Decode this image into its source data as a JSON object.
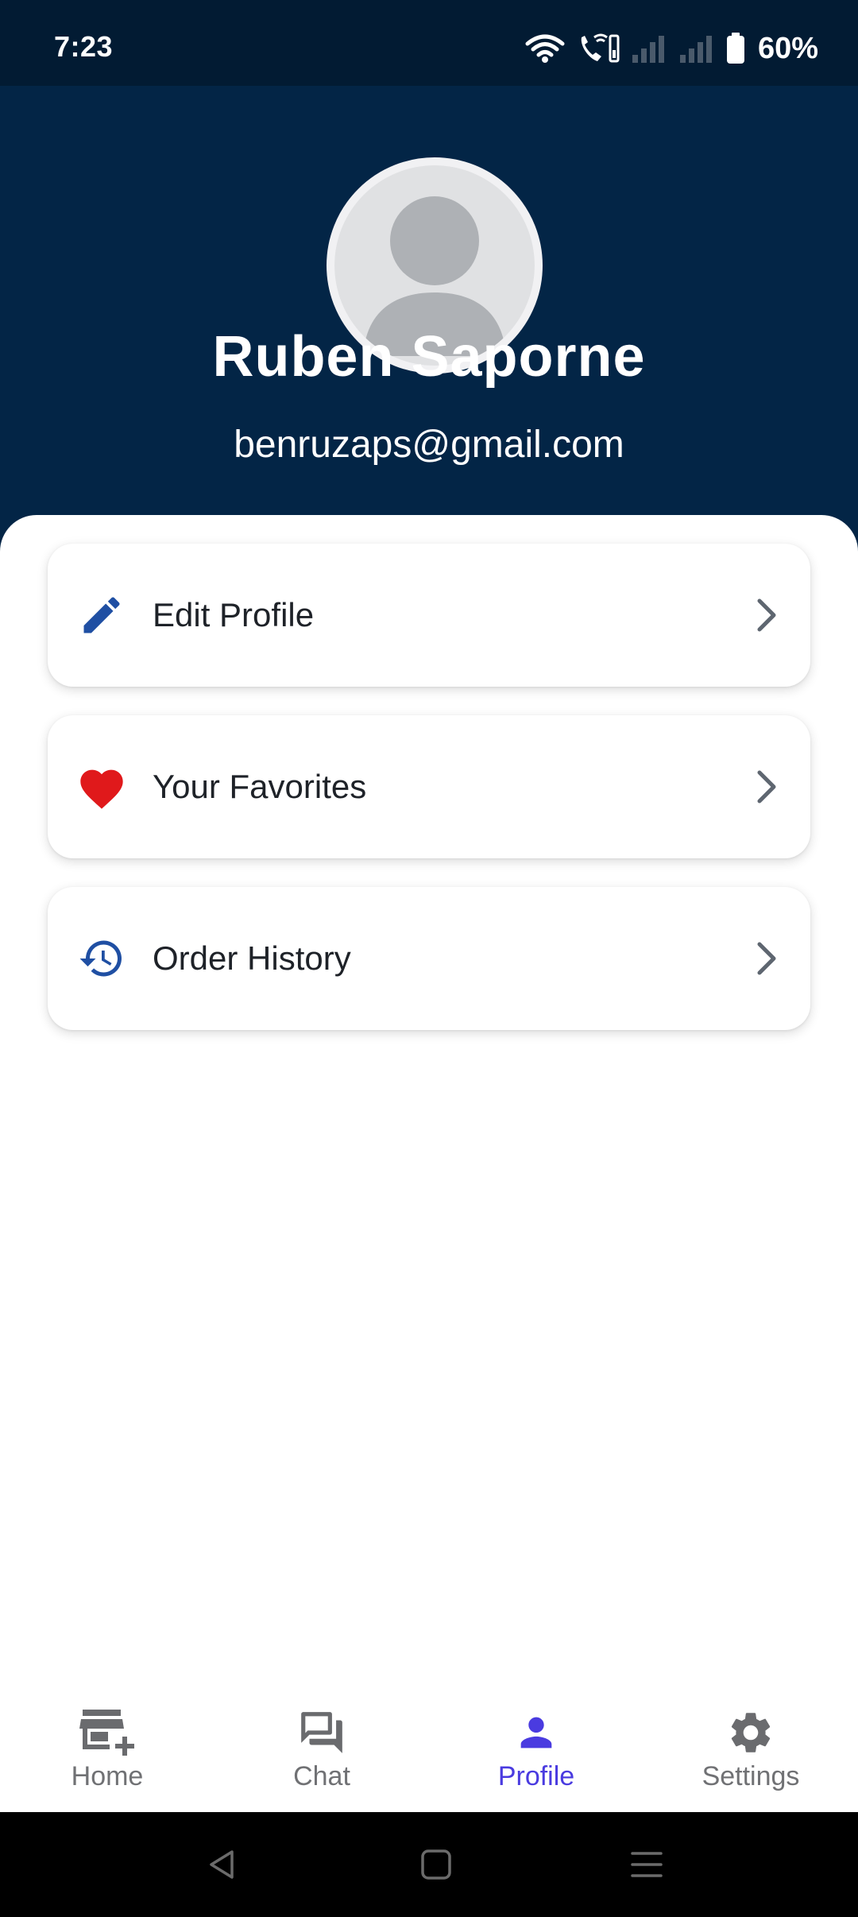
{
  "status_bar": {
    "time": "7:23",
    "battery": "60%"
  },
  "profile": {
    "name": "Ruben Saporne",
    "email": "benruzaps@gmail.com"
  },
  "menu": [
    {
      "label": "Edit Profile",
      "icon": "pencil-icon",
      "color": "#1f4fa3"
    },
    {
      "label": "Your Favorites",
      "icon": "heart-icon",
      "color": "#e0191b"
    },
    {
      "label": "Order History",
      "icon": "history-icon",
      "color": "#1f4fa3"
    }
  ],
  "bottom_nav": [
    {
      "label": "Home",
      "icon": "store-add-icon",
      "active": false
    },
    {
      "label": "Chat",
      "icon": "chat-icon",
      "active": false
    },
    {
      "label": "Profile",
      "icon": "person-icon",
      "active": true
    },
    {
      "label": "Settings",
      "icon": "gear-icon",
      "active": false
    }
  ],
  "colors": {
    "header_bg": "#032546",
    "status_bg": "#021b33",
    "accent": "#4a3be0",
    "icon_blue": "#1f4fa3",
    "heart_red": "#e0191b"
  }
}
